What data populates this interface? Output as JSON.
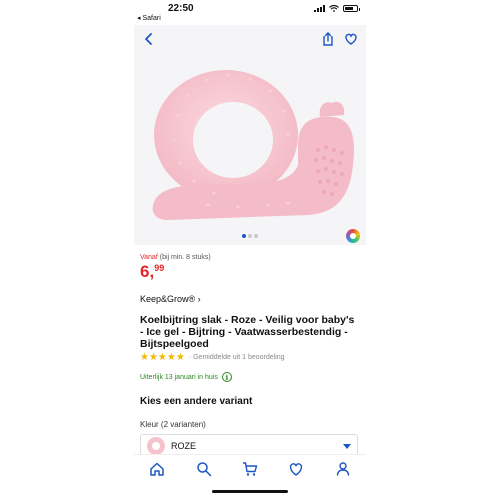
{
  "status": {
    "time": "22:50",
    "back_app": "◂ Safari"
  },
  "gallery": {
    "dots_count": 3,
    "active_index": 0
  },
  "product": {
    "price_prefix": "Vanaf",
    "price_note": "(bij min. 8 stuks)",
    "price_int": "6,",
    "price_cents": "99",
    "brand": "Keep&Grow® ›",
    "title": "Koelbijtring slak - Roze - Veilig voor baby's - Ice gel - Bijtring - Vaatwasserbestendig - Bijtspeelgoed",
    "stars": "★★★★★",
    "rating_text": "· Gemiddelde uit 1 beoordeling",
    "delivery": "Uiterlijk 13 januari in huis"
  },
  "variant": {
    "heading": "Kies een andere variant",
    "color_label": "Kleur (2 varianten)",
    "selected": "ROZE"
  },
  "tabs": [
    "home-icon",
    "search-icon",
    "cart-icon",
    "heart-icon",
    "user-icon"
  ],
  "colors": {
    "accent": "#1a56c4",
    "price": "#e4262c",
    "delivery": "#2a8a22",
    "stars": "#f6b800",
    "product": "#f6c3cd"
  }
}
